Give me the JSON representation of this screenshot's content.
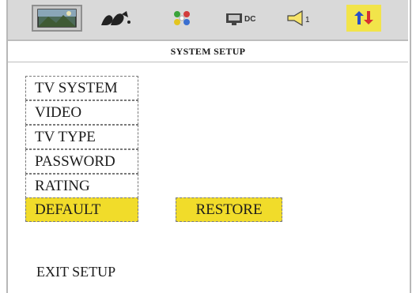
{
  "toolbar": {
    "icons": [
      {
        "name": "landscape-picture-icon",
        "selected": true
      },
      {
        "name": "dolby-icon"
      },
      {
        "name": "color-dots-icon"
      },
      {
        "name": "tv-dc-icon"
      },
      {
        "name": "speaker-icon"
      },
      {
        "name": "swap-arrows-icon",
        "highlighted": true
      }
    ]
  },
  "header": {
    "title": "SYSTEM SETUP"
  },
  "menu": {
    "items": [
      {
        "label": "TV SYSTEM"
      },
      {
        "label": "VIDEO"
      },
      {
        "label": "TV TYPE"
      },
      {
        "label": "PASSWORD"
      },
      {
        "label": "RATING"
      },
      {
        "label": "DEFAULT",
        "active": true
      }
    ],
    "exit_label": "EXIT SETUP"
  },
  "submenu": {
    "restore_label": "RESTORE"
  },
  "colors": {
    "highlight": "#f1dc2a",
    "toolbar_bg": "#d9d9d9",
    "border": "#7a7a7a"
  }
}
